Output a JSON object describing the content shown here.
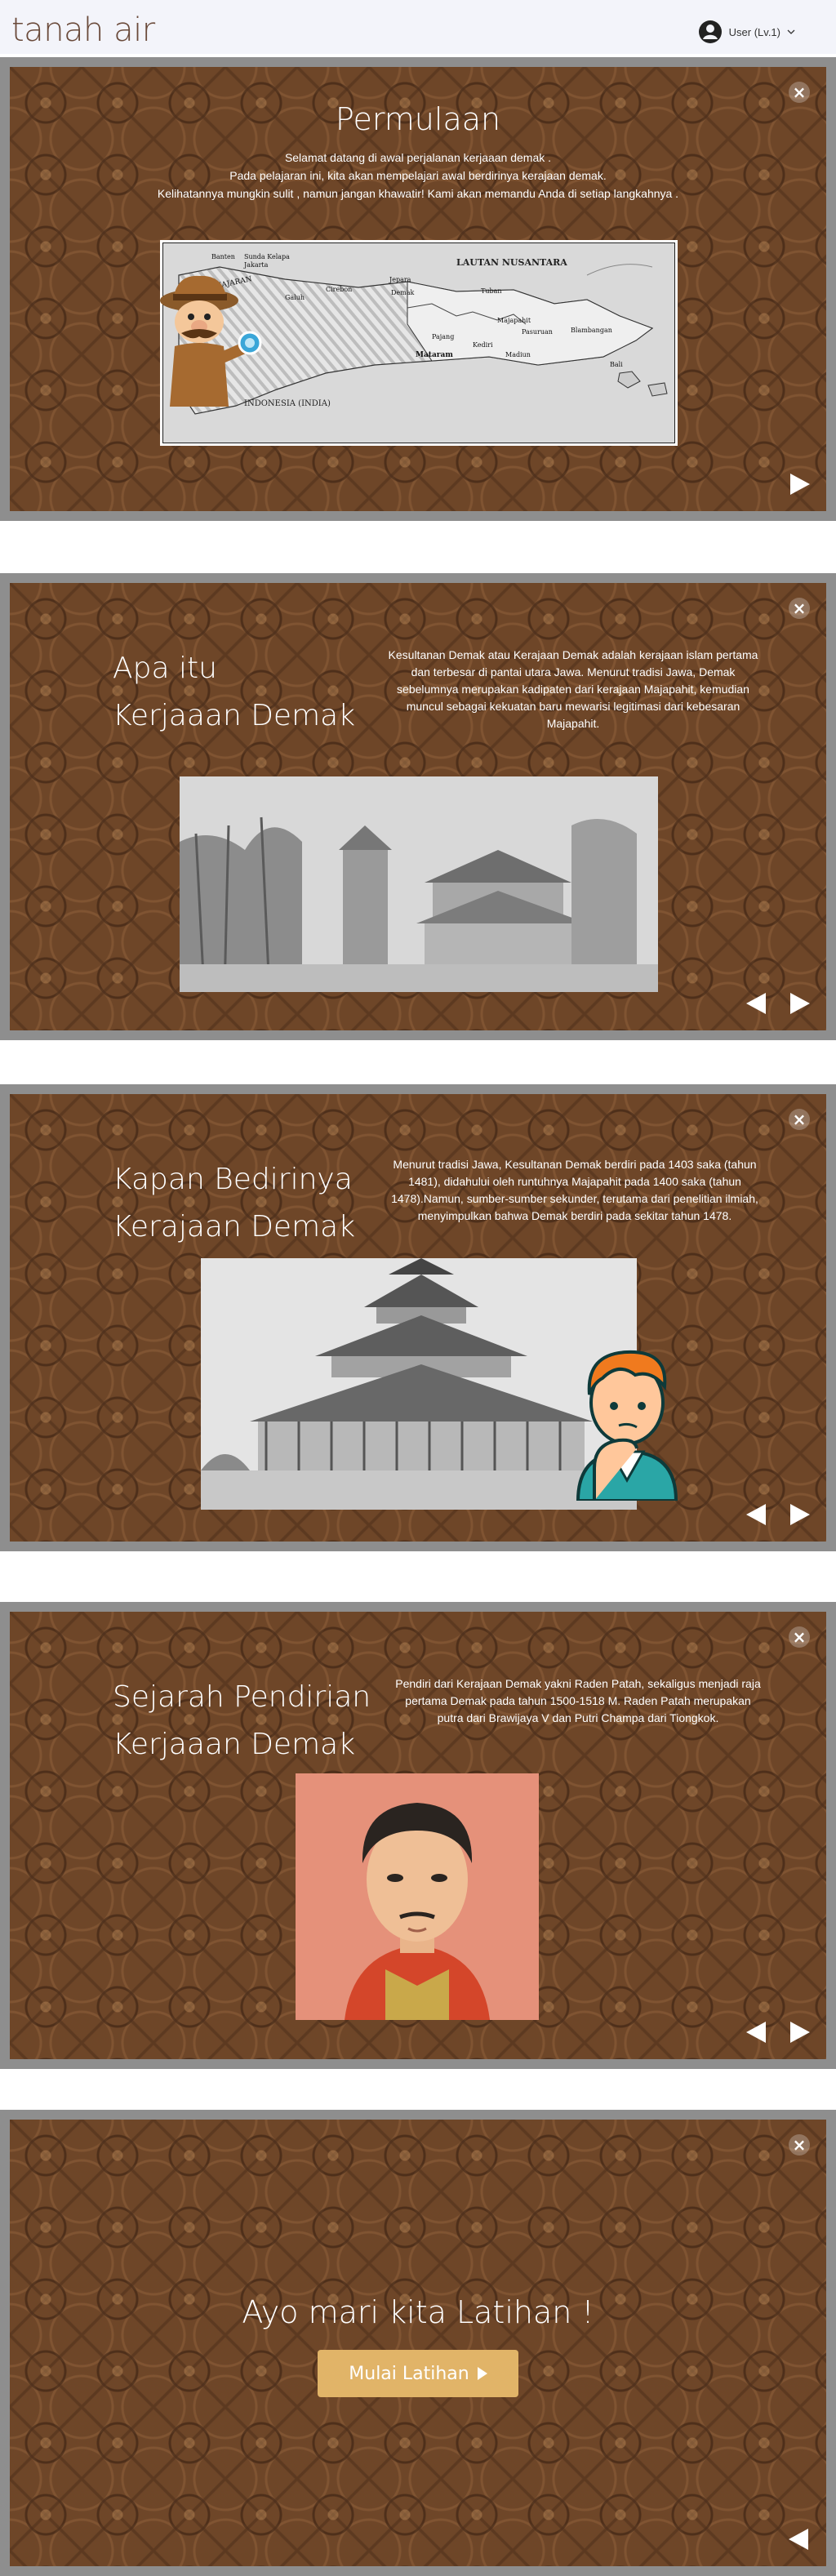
{
  "app": {
    "brand": "tanah air"
  },
  "user": {
    "label": "User (Lv.1)"
  },
  "slides": [
    {
      "title": "Permulaan",
      "lines": [
        "Selamat datang di awal perjalanan kerjaaan demak .",
        "Pada pelajaran ini, kita akan mempelajari awal berdirinya kerajaan demak.",
        "Kelihatannya mungkin sulit , namun jangan khawatir! Kami akan memandu Anda di setiap langkahnya ."
      ],
      "map_labels": {
        "sea": "LAUTAN NUSANTARA",
        "ocean": "INDONESIA (INDIA)",
        "places": [
          "Banten",
          "Sunda Kelapa",
          "Jakarta",
          "PAJAJARAN",
          "Galuh",
          "Cirebon",
          "Jepara",
          "Demak",
          "Tuban",
          "Majapahit",
          "Pasuruan",
          "Blambangan",
          "Mataram",
          "Pajang",
          "Kediri",
          "Madiun",
          "Bali"
        ]
      }
    },
    {
      "title_line1": "Apa itu",
      "title_line2": "Kerjaaan Demak",
      "text": "Kesultanan Demak atau Kerajaan Demak adalah kerajaan islam pertama dan terbesar di pantai utara Jawa. Menurut tradisi Jawa, Demak sebelumnya merupakan kadipaten dari kerajaan Majapahit, kemudian muncul sebagai kekuatan baru mewarisi legitimasi dari kebesaran Majapahit."
    },
    {
      "title_line1": "Kapan Bedirinya",
      "title_line2": "Kerajaan Demak",
      "text": "Menurut tradisi Jawa, Kesultanan Demak berdiri pada 1403 saka (tahun 1481), didahului oleh runtuhnya Majapahit pada 1400 saka (tahun 1478).Namun, sumber-sumber sekunder, terutama dari penelitian ilmiah, menyimpulkan bahwa Demak berdiri pada sekitar tahun 1478."
    },
    {
      "title_line1": "Sejarah Pendirian",
      "title_line2": "Kerjaaan Demak",
      "text": "Pendiri dari Kerajaan Demak yakni Raden Patah, sekaligus menjadi raja pertama Demak pada tahun 1500-1518 M. Raden Patah merupakan putra dari Brawijaya V dan Putri Champa dari Tiongkok."
    },
    {
      "title": "Ayo mari kita Latihan !",
      "button_label": "Mulai Latihan"
    }
  ],
  "colors": {
    "topbar_bg": "#f3f4fa",
    "brand": "#6a4a3a",
    "frame": "#8e8e8e",
    "batik_bg": "#6e4628",
    "cta_button": "#e1b468"
  },
  "icons": {
    "close": "close-icon",
    "prev": "arrow-left-icon",
    "next": "arrow-right-icon",
    "user": "user-circle-icon",
    "chevron": "chevron-down-icon"
  }
}
